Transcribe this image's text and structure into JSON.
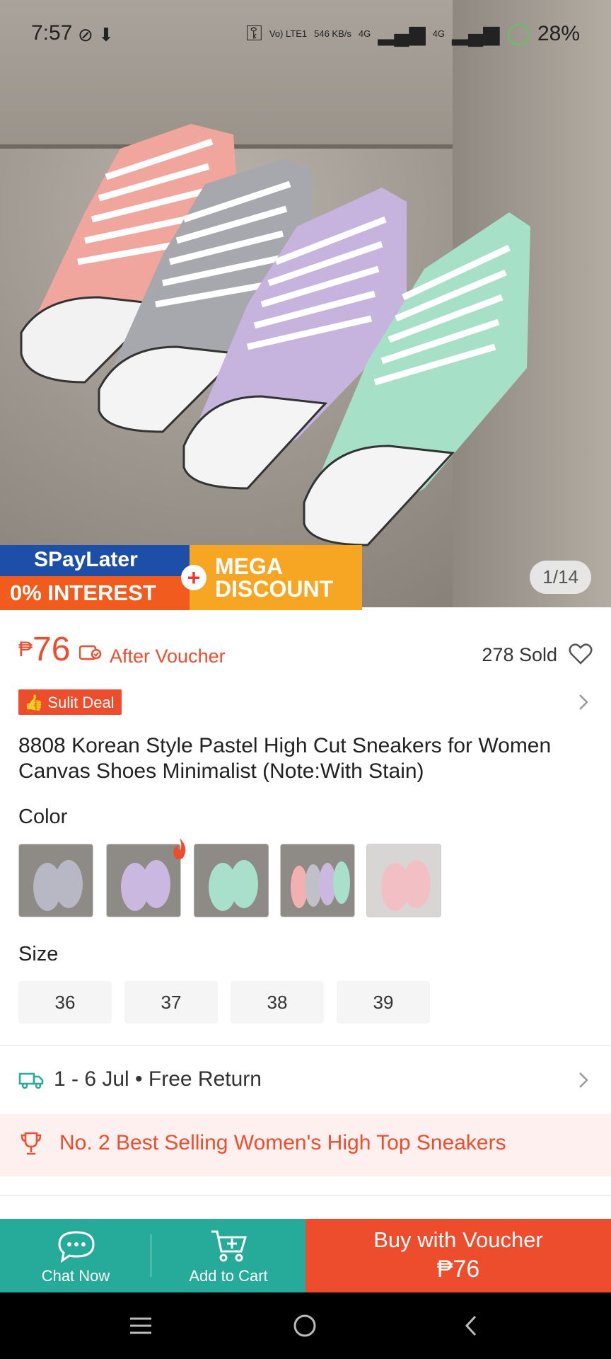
{
  "status_bar": {
    "time": "7:57",
    "net_lte": "Vo) LTE1",
    "net_speed": "546 KB/s",
    "net_4g_1": "4G",
    "net_4g_2": "4G",
    "battery": "28%"
  },
  "hero": {
    "banner_spaylater": "SPayLater",
    "banner_interest": "0% INTEREST",
    "banner_mega": "MEGA",
    "banner_discount": "DISCOUNT",
    "image_counter": "1/14"
  },
  "price": {
    "currency": "₱",
    "amount": "76",
    "after_voucher": "After Voucher",
    "sold": "278 Sold"
  },
  "deal_badge": "Sulit Deal",
  "product_title": "8808 Korean Style Pastel High Cut Sneakers for Women Canvas Shoes Minimalist (Note:With Stain)",
  "color": {
    "label": "Color",
    "options": [
      {
        "icon": "grey-sneakers-thumb",
        "color": "#b8b8c4"
      },
      {
        "icon": "purple-sneakers-thumb",
        "color": "#cbb8e0"
      },
      {
        "icon": "mint-sneakers-thumb",
        "color": "#a8e0cc"
      },
      {
        "icon": "mixed-sneakers-thumb",
        "color": "#c8b0c8"
      },
      {
        "icon": "pink-sneakers-thumb",
        "color": "#f2c0c4"
      }
    ]
  },
  "size": {
    "label": "Size",
    "options": [
      "36",
      "37",
      "38",
      "39"
    ]
  },
  "shipping": {
    "text": "1 - 6 Jul • Free Return"
  },
  "ranking": {
    "text": "No. 2 Best Selling Women's High Top Sneakers"
  },
  "bottom_bar": {
    "chat": "Chat Now",
    "cart": "Add to Cart",
    "buy_line1": "Buy with Voucher",
    "buy_line2": "₱76"
  },
  "colors": {
    "accent": "#ee4d2d",
    "teal": "#26aa99",
    "best_bg": "#fdf0ee"
  }
}
